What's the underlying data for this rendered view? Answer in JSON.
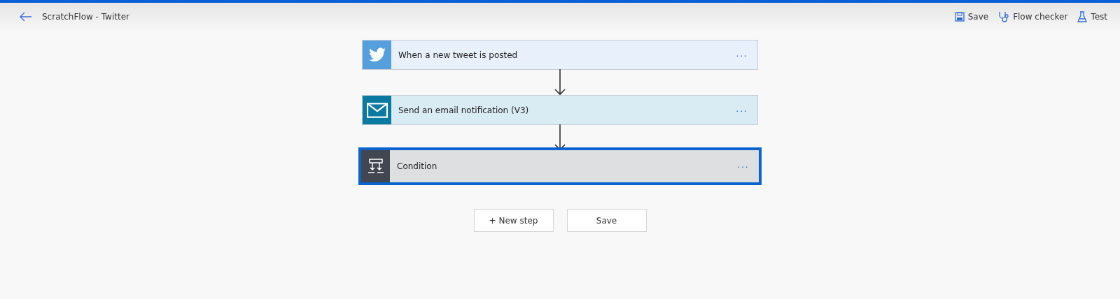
{
  "header": {
    "title": "ScratchFlow - Twitter",
    "actions": [
      {
        "kind": "save",
        "label": "Save"
      },
      {
        "kind": "checker",
        "label": "Flow checker"
      },
      {
        "kind": "test",
        "label": "Test"
      }
    ]
  },
  "steps": [
    {
      "kind": "twitter",
      "title": "When a new tweet is posted",
      "more": "···",
      "selected": false
    },
    {
      "kind": "email",
      "title": "Send an email notification (V3)",
      "more": "···",
      "selected": false
    },
    {
      "kind": "condition",
      "title": "Condition",
      "more": "···",
      "selected": true
    }
  ],
  "buttons": [
    "+ New step",
    "Save"
  ]
}
